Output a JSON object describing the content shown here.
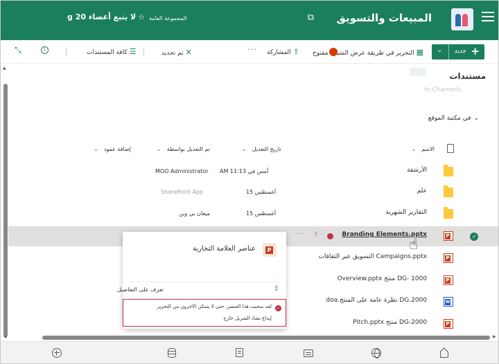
{
  "header": {
    "site_title": "المبيعات والتسويق",
    "group_type": "المجموعة العامة",
    "follow_label": "لا يتبع أعضاء 20 g",
    "brand_color": "#1b7f5e"
  },
  "command_bar": {
    "new_label": "جديد",
    "edit_grid_label": "التحرير في طريقة عرض الشبكة",
    "open_label": "مفتوح",
    "share_label": "المشاركة",
    "more_label": "···",
    "selected_label": "تم تحديد",
    "view_label": "كافة المستندات"
  },
  "library": {
    "title": "مستندات",
    "ghost_label": "In Channels",
    "site_library_label": "في مكتبة الموقع"
  },
  "columns": {
    "name": "الاسم",
    "modified": "تاريخ التعديل",
    "modified_by": "تم التعديل بواسطة",
    "add_column": "إضافة عمود"
  },
  "rows": [
    {
      "name": "الأرشفة",
      "modified": "أمس في 11:13 AM",
      "modified_by": "MOO Administrator",
      "type": "folder"
    },
    {
      "name": "علم",
      "modified": "أغسطس 15",
      "modified_by": "SharePoint App",
      "type": "folder"
    },
    {
      "name": "التقارير الشهرية",
      "modified": "أغسطس 15",
      "modified_by": "ميغان بي وين",
      "type": "folder"
    },
    {
      "name": "Branding Elements.pptx",
      "type": "ppt",
      "selected": true
    },
    {
      "name": "Campaigns.pptx التسويق عبر الثقافات",
      "type": "ppt"
    },
    {
      "name": "DG- 1000 منتج Overview.pptx",
      "type": "ppt"
    },
    {
      "name": "DG.2000 نظرة عامة على المنتج.doa",
      "type": "word"
    },
    {
      "name": "DG-2000 منتج Pitch.pptx",
      "type": "ppt"
    }
  ],
  "hover_card": {
    "title": "عناصر العلامة التجارية",
    "details_link": "تعرف على التفاصيل",
    "checkout_message": "لقد سحبت هذا العنصر، حتى لا يتمكن الآخرون من التحرير",
    "discard_link": "إيداع تشاد الشريل خارج"
  },
  "icons": [
    "waffle-icon",
    "site-logo",
    "teams-icon",
    "star-icon",
    "plus-icon",
    "grid-edit-icon",
    "share-icon",
    "close-icon",
    "filter-icon",
    "info-icon",
    "expand-icon",
    "folder-icon",
    "powerpoint-icon",
    "word-icon",
    "home-icon",
    "globe-icon",
    "news-icon",
    "document-icon",
    "database-icon",
    "add-circle-icon"
  ]
}
